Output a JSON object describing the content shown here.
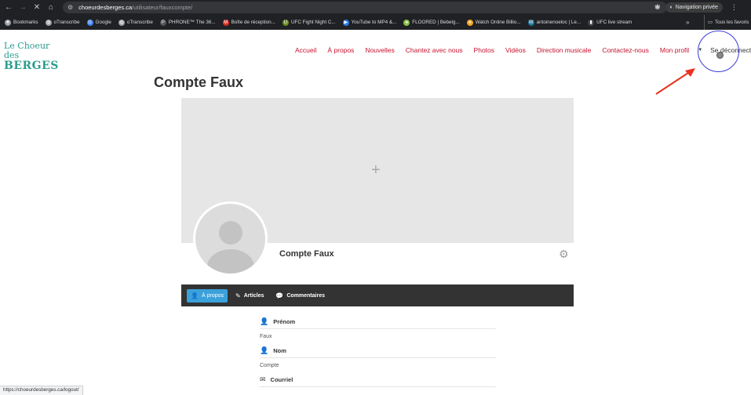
{
  "browser": {
    "url_host": "choeurdesberges.ca",
    "url_path": "/utilisateur/fauxcompte/",
    "private_label": "Navigation privée",
    "bookmarks": [
      {
        "label": "Bookmarks",
        "icon": "star-icon",
        "color": "#9aa0a6"
      },
      {
        "label": "oTranscribe",
        "icon": "globe-icon",
        "color": "#9aa0a6"
      },
      {
        "label": "Google",
        "icon": "google-icon",
        "color": "#4285f4"
      },
      {
        "label": "oTranscribe",
        "icon": "globe-icon",
        "color": "#9aa0a6"
      },
      {
        "label": "PHRONE™ The 36...",
        "icon": "phrone-icon",
        "color": "#555555"
      },
      {
        "label": "Boîte de réception...",
        "icon": "gmail-icon",
        "color": "#d93025"
      },
      {
        "label": "UFC Fight Night C...",
        "icon": "ufc-icon",
        "color": "#6b8e23"
      },
      {
        "label": "YouTube to MP4 &...",
        "icon": "youtube-icon",
        "color": "#2b7de9"
      },
      {
        "label": "FLOORED | Bebelg...",
        "icon": "floored-icon",
        "color": "#8bc34a"
      },
      {
        "label": "Watch Online Billio...",
        "icon": "watch-icon",
        "color": "#f5a623"
      },
      {
        "label": "antoinenoeloc | Le...",
        "icon": "blog-icon",
        "color": "#21759b"
      },
      {
        "label": "UFC live stream",
        "icon": "stream-icon",
        "color": "#444444"
      }
    ],
    "all_bookmarks_label": "Tous les favoris",
    "more_label": "»",
    "status_url": "https://choeurdesberges.ca/logout/"
  },
  "site": {
    "logo_line1": "Le Choeur des",
    "logo_line2": "BERGES",
    "nav": [
      "Accueil",
      "À propos",
      "Nouvelles",
      "Chantez avec nous",
      "Photos",
      "Vidéos",
      "Direction musicale",
      "Contactez-nous",
      "Mon profil"
    ],
    "logout_label": "Se déconnecter",
    "accent_color": "#c8102e"
  },
  "profile": {
    "page_title": "Compte Faux",
    "display_name": "Compte Faux",
    "tabs": [
      {
        "label": "À propos",
        "icon": "user-icon"
      },
      {
        "label": "Articles",
        "icon": "pencil-icon"
      },
      {
        "label": "Commentaires",
        "icon": "comment-icon"
      }
    ],
    "fields": [
      {
        "label": "Prénom",
        "value": "Faux",
        "icon": "user-icon"
      },
      {
        "label": "Nom",
        "value": "Compte",
        "icon": "user-icon"
      },
      {
        "label": "Courriel",
        "value": "",
        "icon": "envelope-icon"
      }
    ]
  }
}
